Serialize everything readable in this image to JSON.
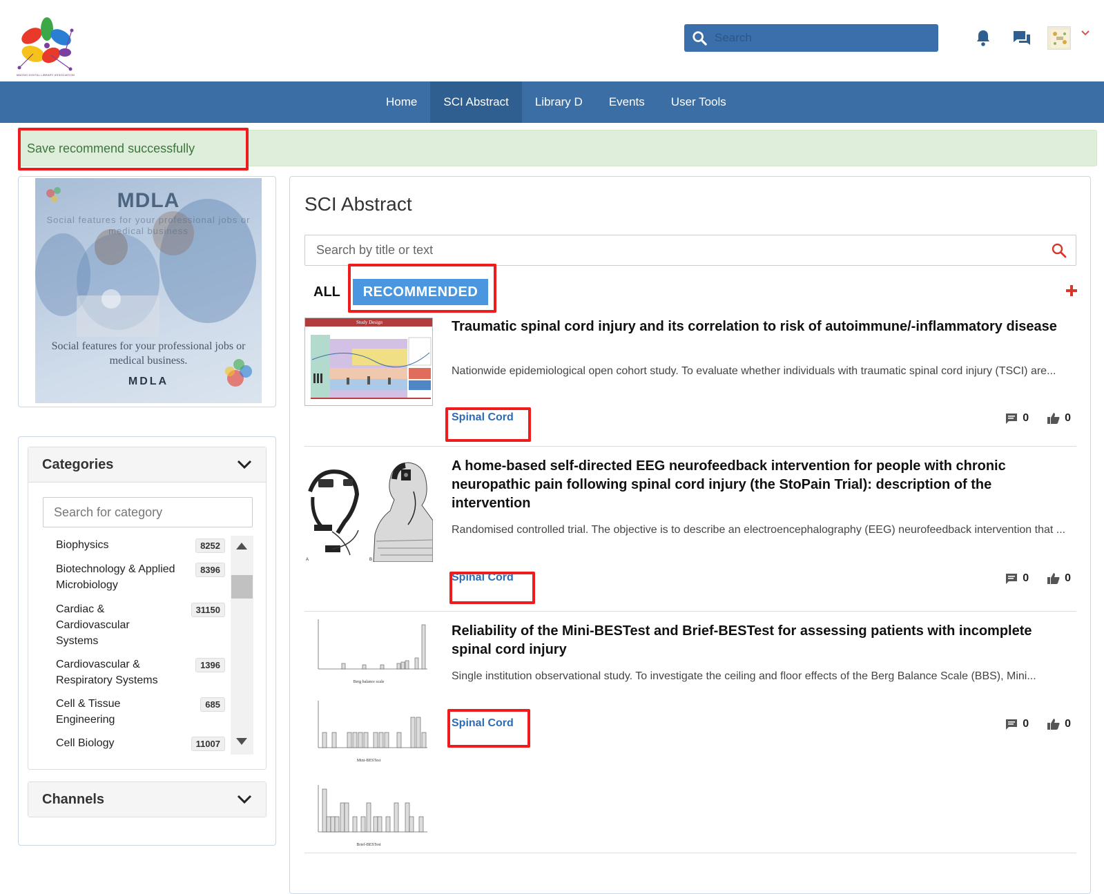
{
  "header": {
    "logo_caption": "MAGNO DIGITAL LIBRARY ASSOCIATION",
    "search_placeholder": "Search"
  },
  "nav": {
    "items": [
      {
        "label": "Home"
      },
      {
        "label": "SCI Abstract",
        "active": true
      },
      {
        "label": "Library D"
      },
      {
        "label": "Events"
      },
      {
        "label": "User Tools"
      }
    ]
  },
  "alert": {
    "message": "Save recommend successfully"
  },
  "promo": {
    "title": "MDLA",
    "subtitle": "Social features for your professional jobs or medical business",
    "text": "Social features for your professional jobs or medical business.",
    "brand": "MDLA"
  },
  "categories": {
    "heading": "Categories",
    "search_placeholder": "Search for category",
    "items": [
      {
        "name": "Biophysics",
        "count": "8252"
      },
      {
        "name": "Biotechnology & Applied Microbiology",
        "count": "8396"
      },
      {
        "name": "Cardiac & Cardiovascular Systems",
        "count": "31150"
      },
      {
        "name": "Cardiovascular & Respiratory Systems",
        "count": "1396"
      },
      {
        "name": "Cell & Tissue Engineering",
        "count": "685"
      },
      {
        "name": "Cell Biology",
        "count": "11007"
      }
    ]
  },
  "channels": {
    "heading": "Channels"
  },
  "main": {
    "title": "SCI Abstract",
    "search_placeholder": "Search by title or text",
    "tab_all": "ALL",
    "tab_recommended": "RECOMMENDED",
    "articles": [
      {
        "title": "Traumatic spinal cord injury and its correlation to risk of autoimmune/-inflammatory disease",
        "description": "Nationwide epidemiological open cohort study. To evaluate whether individuals with traumatic spinal cord injury (TSCI) are...",
        "tag": "Spinal Cord",
        "comments": "0",
        "likes": "0",
        "thumb_header": "Study Design"
      },
      {
        "title": "A home-based self-directed EEG neurofeedback intervention for people with chronic neuropathic pain following spinal cord injury (the StoPain Trial): description of the intervention",
        "description": "Randomised controlled trial. The objective is to describe an electroencephalography (EEG) neurofeedback intervention that ...",
        "tag": "Spinal Cord",
        "comments": "0",
        "likes": "0"
      },
      {
        "title": "Reliability of the Mini-BESTest and Brief-BESTest for assessing patients with incomplete spinal cord injury",
        "description": "Single institution observational study. To investigate the ceiling and floor effects of the Berg Balance Scale (BBS), Mini...",
        "tag": "Spinal Cord",
        "comments": "0",
        "likes": "0",
        "thumb_labels": [
          "Berg balance scale",
          "Mini-BESTest",
          "Brief-BESTest"
        ]
      }
    ]
  },
  "colors": {
    "nav_bg": "#3a6ea5",
    "accent": "#4a97e0",
    "highlight": "#ee1c1c",
    "alert_bg": "#dfeedb",
    "tag": "#2d6cb5"
  }
}
